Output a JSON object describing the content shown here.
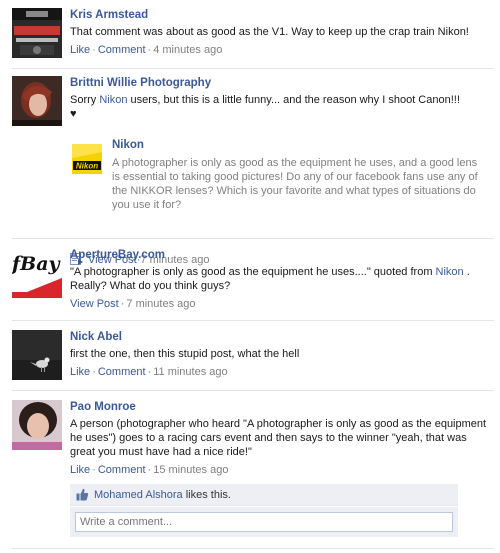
{
  "stories": [
    {
      "author": "Kris Armstead",
      "avatar_icon": "powershoot-avatar",
      "message": "That comment was about as good as the V1. Way to keep up the crap train Nikon!",
      "like_label": "Like",
      "comment_label": "Comment",
      "timestamp": "4 minutes ago"
    },
    {
      "author": "Brittni Willie Photography",
      "avatar_icon": "person-portrait-avatar",
      "message_before": "Sorry ",
      "message_link": "Nikon",
      "message_after": " users, but this is a little funny... and the reason why I shoot Canon!!!",
      "heart": "♥",
      "attachment": {
        "logo_icon": "nikon-logo-icon",
        "logo_text": "Nikon",
        "title": "Nikon",
        "description": "A photographer is only as good as the equipment he uses, and a good lens is essential to taking good pictures! Do any of our facebook fans use any of the NIKKOR lenses? Which is your favorite and what types of situations do you use it for?",
        "view_label": "View Post",
        "timestamp": "7 minutes ago"
      }
    },
    {
      "author": "ApertureBay.com",
      "avatar_icon": "aperturebay-logo-avatar",
      "avatar_text": "fBay",
      "message_before": "\"A photographer is only as good as the equipment he uses....\" quoted from ",
      "message_link": "Nikon",
      "message_after": " . Really? What do you think guys?",
      "view_label": "View Post",
      "timestamp": "7 minutes ago"
    },
    {
      "author": "Nick Abel",
      "avatar_icon": "bird-silhouette-avatar",
      "message": "first the one, then this stupid post, what the hell",
      "like_label": "Like",
      "comment_label": "Comment",
      "timestamp": "11 minutes ago"
    },
    {
      "author": "Pao Monroe",
      "avatar_icon": "person-portrait-avatar",
      "message": "A person (photographer who heard \"A photographer is only as good as the equipment he uses\") goes to a racing cars event and then says to the winner \"yeah, that was great you must have had a nice ride!\"",
      "like_label": "Like",
      "comment_label": "Comment",
      "timestamp": "15 minutes ago",
      "likes": {
        "name": "Mohamed Alshora",
        "suffix": " likes this."
      },
      "comment_placeholder": "Write a comment..."
    }
  ],
  "separator": "·",
  "colors": {
    "link": "#3b5998",
    "meta": "#808080",
    "likebox_bg": "#edeff4",
    "nikon_yellow": "#f5d300",
    "aperturebay_red": "#d9262c"
  }
}
